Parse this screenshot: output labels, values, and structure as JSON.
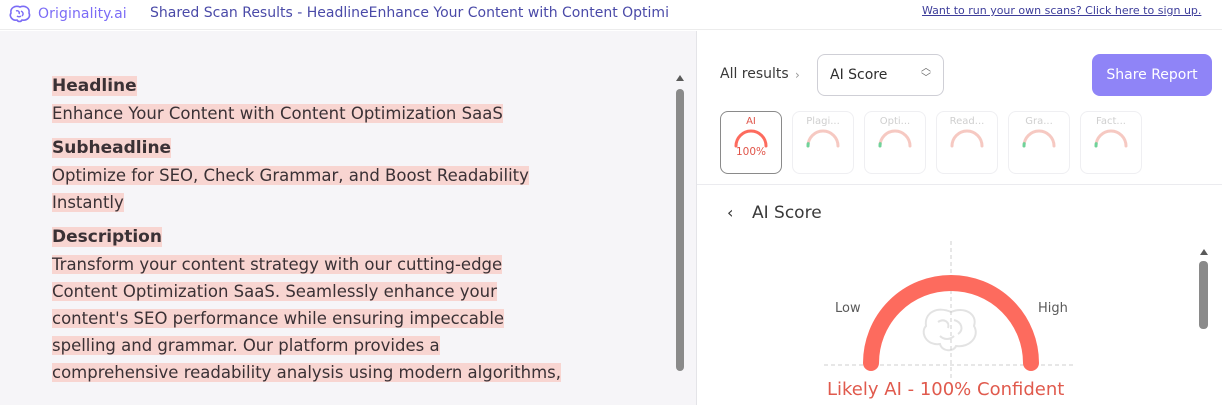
{
  "topbar": {
    "brand_name": "Originality.ai",
    "scan_title": "Shared Scan Results - HeadlineEnhance Your Content with Content Optimi",
    "signup_link": "Want to run your own scans? Click here to sign up."
  },
  "document": {
    "blocks": [
      {
        "heading": "Headline",
        "lines": [
          "Enhance Your Content with Content Optimization SaaS"
        ]
      },
      {
        "heading": "Subheadline",
        "lines": [
          "Optimize for SEO, Check Grammar, and Boost Readability",
          "Instantly"
        ]
      },
      {
        "heading": "Description",
        "lines": [
          "Transform your content strategy with our cutting-edge",
          "Content Optimization SaaS. Seamlessly enhance your",
          "content's SEO performance while ensuring impeccable",
          "spelling and grammar. Our platform provides a",
          "comprehensive readability analysis using modern algorithms,"
        ]
      }
    ],
    "highlight_color": "#f8d5d1"
  },
  "results": {
    "breadcrumb": "All results",
    "selected_report": "AI Score",
    "share_label": "Share Report",
    "tabs": [
      {
        "label": "AI",
        "value": "100%",
        "active": true,
        "fraction": 1.0
      },
      {
        "label": "Plagi...",
        "value": "",
        "active": false,
        "fraction": 0.05
      },
      {
        "label": "Opti...",
        "value": "",
        "active": false,
        "fraction": 0.05
      },
      {
        "label": "Read...",
        "value": "",
        "active": false,
        "fraction": 0.0
      },
      {
        "label": "Gra...",
        "value": "",
        "active": false,
        "fraction": 0.05
      },
      {
        "label": "Fact...",
        "value": "",
        "active": false,
        "fraction": 0.05
      }
    ],
    "section_title": "AI Score",
    "gauge": {
      "low_label": "Low",
      "high_label": "High",
      "fraction": 1.0,
      "verdict": "Likely AI - 100% Confident"
    }
  },
  "colors": {
    "accent": "#8f84f7",
    "ai_red": "#fd6b5e",
    "inactive_arc": "#f6c9c2"
  }
}
